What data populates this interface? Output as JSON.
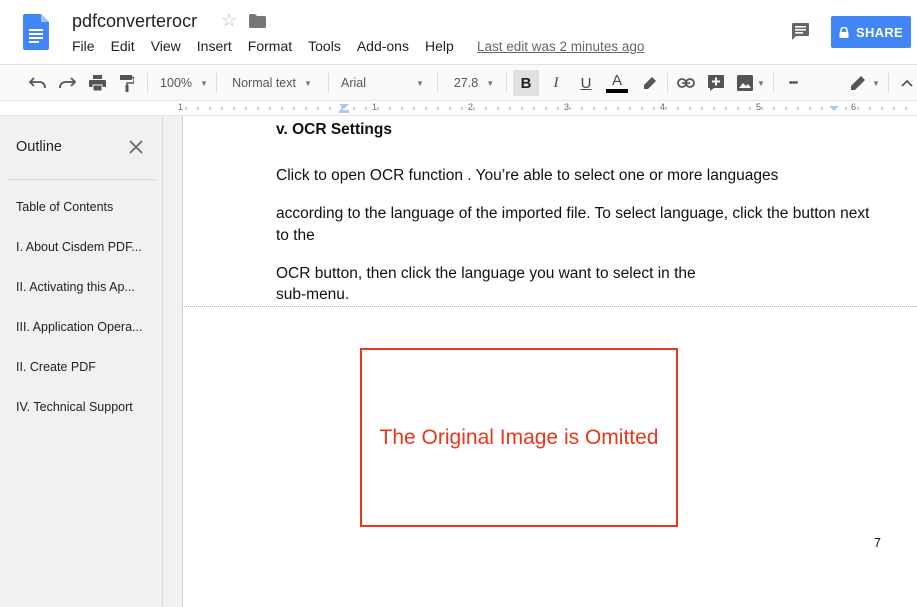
{
  "app": {
    "title": "pdfconverterocr",
    "last_edit": "Last edit was 2 minutes ago",
    "share_label": "SHARE",
    "icons": {
      "logo": "docs-logo",
      "star": "star-icon",
      "folder": "folder-icon",
      "comment": "comment-icon",
      "lock": "lock-icon"
    },
    "accent_color": "#4285f4"
  },
  "menu": {
    "items": [
      "File",
      "Edit",
      "View",
      "Insert",
      "Format",
      "Tools",
      "Add-ons",
      "Help"
    ]
  },
  "toolbar": {
    "zoom": "100%",
    "style": "Normal text",
    "font": "Arial",
    "font_size": "27.8",
    "bold_label": "B",
    "italic_label": "I",
    "underline_label": "U",
    "text_color_label": "A",
    "more_label": "•••"
  },
  "ruler": {
    "numbers": [
      "1",
      "1",
      "2",
      "3",
      "4",
      "5",
      "6"
    ]
  },
  "outline": {
    "title": "Outline",
    "items": [
      "Table of Contents",
      "I. About Cisdem PDF...",
      "II. Activating this Ap...",
      "III. Application Opera...",
      "II. Create PDF",
      "IV. Technical Support"
    ]
  },
  "document": {
    "heading": "v. OCR Settings",
    "paragraphs": [
      "Click to open OCR function . You’re able to select one or more languages",
      "according to the language of the imported file. To select language, click the button next",
      "to the",
      "OCR button, then click the language you want to select in the",
      "sub-menu."
    ],
    "image_placeholder": "The Original Image is Omitted",
    "image_color": "#e8361a",
    "page_number": "7"
  }
}
